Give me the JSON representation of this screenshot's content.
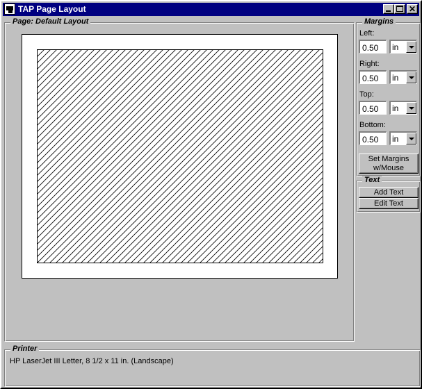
{
  "window": {
    "title": "TAP Page Layout",
    "icon": "app-icon",
    "controls": {
      "minimize": "minimize-icon",
      "maximize": "maximize-icon",
      "close_glyph": "✕"
    }
  },
  "page": {
    "label": "Page:  Default Layout"
  },
  "margins": {
    "label": "Margins",
    "fields": [
      {
        "label": "Left:",
        "value": "0.50",
        "unit": "in"
      },
      {
        "label": "Right:",
        "value": "0.50",
        "unit": "in"
      },
      {
        "label": "Top:",
        "value": "0.50",
        "unit": "in"
      },
      {
        "label": "Bottom:",
        "value": "0.50",
        "unit": "in"
      }
    ],
    "set_margins_line1": "Set Margins",
    "set_margins_line2": "w/Mouse"
  },
  "text_group": {
    "label": "Text",
    "add_text": "Add Text",
    "edit_text": "Edit Text"
  },
  "printer": {
    "label": "Printer",
    "description": "HP LaserJet III Letter, 8 1/2 x 11 in. (Landscape)"
  },
  "colors": {
    "face": "#c0c0c0",
    "titlebar": "#000080",
    "paper": "#ffffff"
  }
}
